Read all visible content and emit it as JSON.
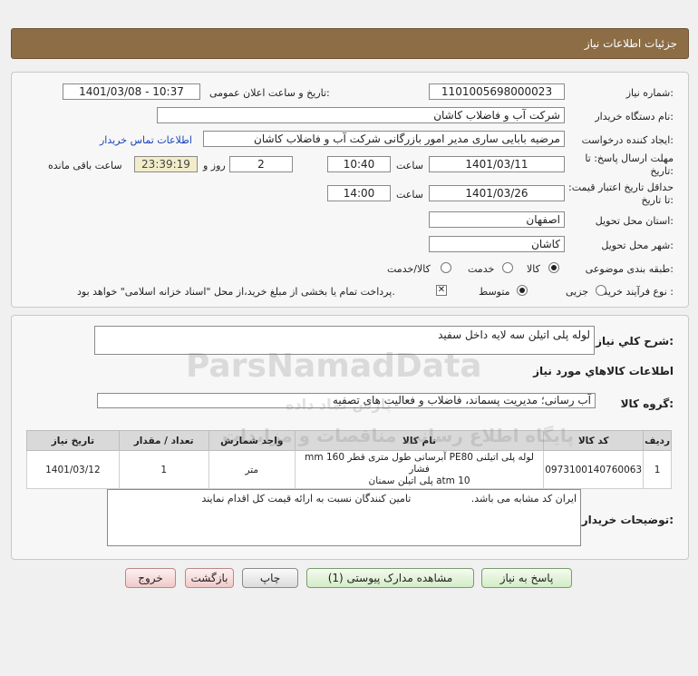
{
  "header": {
    "title": "جزئیات اطلاعات نیاز"
  },
  "form": {
    "need_number_label": "شماره نیاز:",
    "need_number": "1101005698000023",
    "announce_label": "تاریخ و ساعت اعلان عمومی:",
    "announce_value": "1401/03/08 - 10:37",
    "buyer_org_label": "نام دستگاه خریدار:",
    "buyer_org": "شرکت آب و فاضلاب کاشان",
    "requester_label": "ایجاد کننده درخواست:",
    "requester": "مرضیه بابایی ساری مدیر امور بازرگانی شرکت آب و فاضلاب کاشان",
    "contact_link": "اطلاعات تماس خریدار",
    "reply_deadline_label": "مهلت ارسال پاسخ: تا تاریخ:",
    "reply_date": "1401/03/11",
    "time_label": "ساعت",
    "reply_time": "10:40",
    "days_value": "2",
    "days_label": "روز و",
    "remaining_time": "23:39:19",
    "remaining_label": "ساعت باقی مانده",
    "price_validity_label": "حداقل تاریخ اعتبار قیمت: تا تاریخ:",
    "price_date": "1401/03/26",
    "price_time": "14:00",
    "province_label": "استان محل تحویل:",
    "province": "اصفهان",
    "city_label": "شهر محل تحویل:",
    "city": "کاشان",
    "category_label": "طبقه بندی موضوعی:",
    "category_options": [
      "کالا",
      "خدمت",
      "کالا/خدمت"
    ],
    "process_label": "نوع فرآیند خرید :",
    "process_options": [
      "جزیی",
      "متوسط"
    ],
    "payment_note": "پرداخت تمام یا بخشی از مبلغ خرید،از محل \"اسناد خزانه اسلامی\" خواهد بود."
  },
  "summary": {
    "label": "شرح کلي نياز:",
    "value": "لوله پلی اتیلن سه لایه داخل سفید"
  },
  "goods": {
    "section_title": "اطلاعات کالاهاي مورد نياز",
    "group_label": "گروه کالا:",
    "group_value": "آب رسانی؛ مدیریت پسماند، فاضلاب و فعالیت های تصفیه",
    "columns": [
      "ردیف",
      "کد کالا",
      "نام کالا",
      "واحد شمارش",
      "تعداد / مقدار",
      "تاریخ نیاز"
    ],
    "rows": [
      {
        "index": "1",
        "code": "0973100140760063",
        "name_line1": "لوله پلی اتیلنی PE80 آبرسانی طول متری قطر 160 mm فشار",
        "name_line2": "10 atm پلی اتیلن سمنان",
        "unit": "متر",
        "quantity": "1",
        "date": "1401/03/12"
      }
    ]
  },
  "buyer_notes": {
    "label": "توضیحات خریدار:",
    "text": "ایران کد مشابه می باشد.                   تامین کنندگان نسبت به ارائه قیمت کل اقدام نمایند"
  },
  "buttons": {
    "reply": "پاسخ به نیاز",
    "attachments": "مشاهده مدارک پیوستی (1)",
    "print": "چاپ",
    "back": "بازگشت",
    "exit": "خروج"
  },
  "watermark": {
    "brand": "ParsNamadData",
    "line1": "پایگاه اطلاع رسانی مناقصات و مزایدات",
    "line2": "پارس نماد داده"
  }
}
